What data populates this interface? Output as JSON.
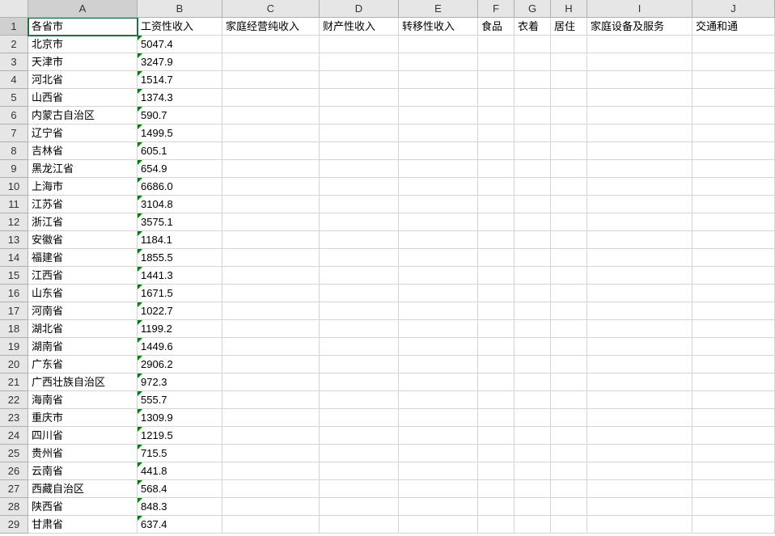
{
  "columns": [
    {
      "id": "A",
      "width": "w-a"
    },
    {
      "id": "B",
      "width": "w-b"
    },
    {
      "id": "C",
      "width": "w-c"
    },
    {
      "id": "D",
      "width": "w-d"
    },
    {
      "id": "E",
      "width": "w-e"
    },
    {
      "id": "F",
      "width": "w-f"
    },
    {
      "id": "G",
      "width": "w-g"
    },
    {
      "id": "H",
      "width": "w-h"
    },
    {
      "id": "I",
      "width": "w-i"
    },
    {
      "id": "J",
      "width": "w-j"
    }
  ],
  "headers": {
    "A": "各省市",
    "B": "工资性收入",
    "C": "家庭经营纯收入",
    "D": "财产性收入",
    "E": "转移性收入",
    "F": "食品",
    "G": "衣着",
    "H": "居住",
    "I": "家庭设备及服务",
    "J": "交通和通"
  },
  "rows": [
    {
      "A": "北京市",
      "B": "5047.4"
    },
    {
      "A": "天津市",
      "B": "3247.9"
    },
    {
      "A": "河北省",
      "B": "1514.7"
    },
    {
      "A": "山西省",
      "B": "1374.3"
    },
    {
      "A": "内蒙古自治区",
      "B": "590.7"
    },
    {
      "A": "辽宁省",
      "B": "1499.5"
    },
    {
      "A": "吉林省",
      "B": "605.1"
    },
    {
      "A": "黑龙江省",
      "B": "654.9"
    },
    {
      "A": "上海市",
      "B": "6686.0"
    },
    {
      "A": "江苏省",
      "B": "3104.8"
    },
    {
      "A": "浙江省",
      "B": "3575.1"
    },
    {
      "A": "安徽省",
      "B": "1184.1"
    },
    {
      "A": "福建省",
      "B": "1855.5"
    },
    {
      "A": "江西省",
      "B": "1441.3"
    },
    {
      "A": "山东省",
      "B": "1671.5"
    },
    {
      "A": "河南省",
      "B": "1022.7"
    },
    {
      "A": "湖北省",
      "B": "1199.2"
    },
    {
      "A": "湖南省",
      "B": "1449.6"
    },
    {
      "A": "广东省",
      "B": "2906.2"
    },
    {
      "A": "广西壮族自治区",
      "B": "972.3"
    },
    {
      "A": "海南省",
      "B": "555.7"
    },
    {
      "A": "重庆市",
      "B": "1309.9"
    },
    {
      "A": "四川省",
      "B": "1219.5"
    },
    {
      "A": "贵州省",
      "B": "715.5"
    },
    {
      "A": "云南省",
      "B": "441.8"
    },
    {
      "A": "西藏自治区",
      "B": "568.4"
    },
    {
      "A": "陕西省",
      "B": "848.3"
    },
    {
      "A": "甘肃省",
      "B": "637.4"
    }
  ],
  "activeCell": "A1"
}
